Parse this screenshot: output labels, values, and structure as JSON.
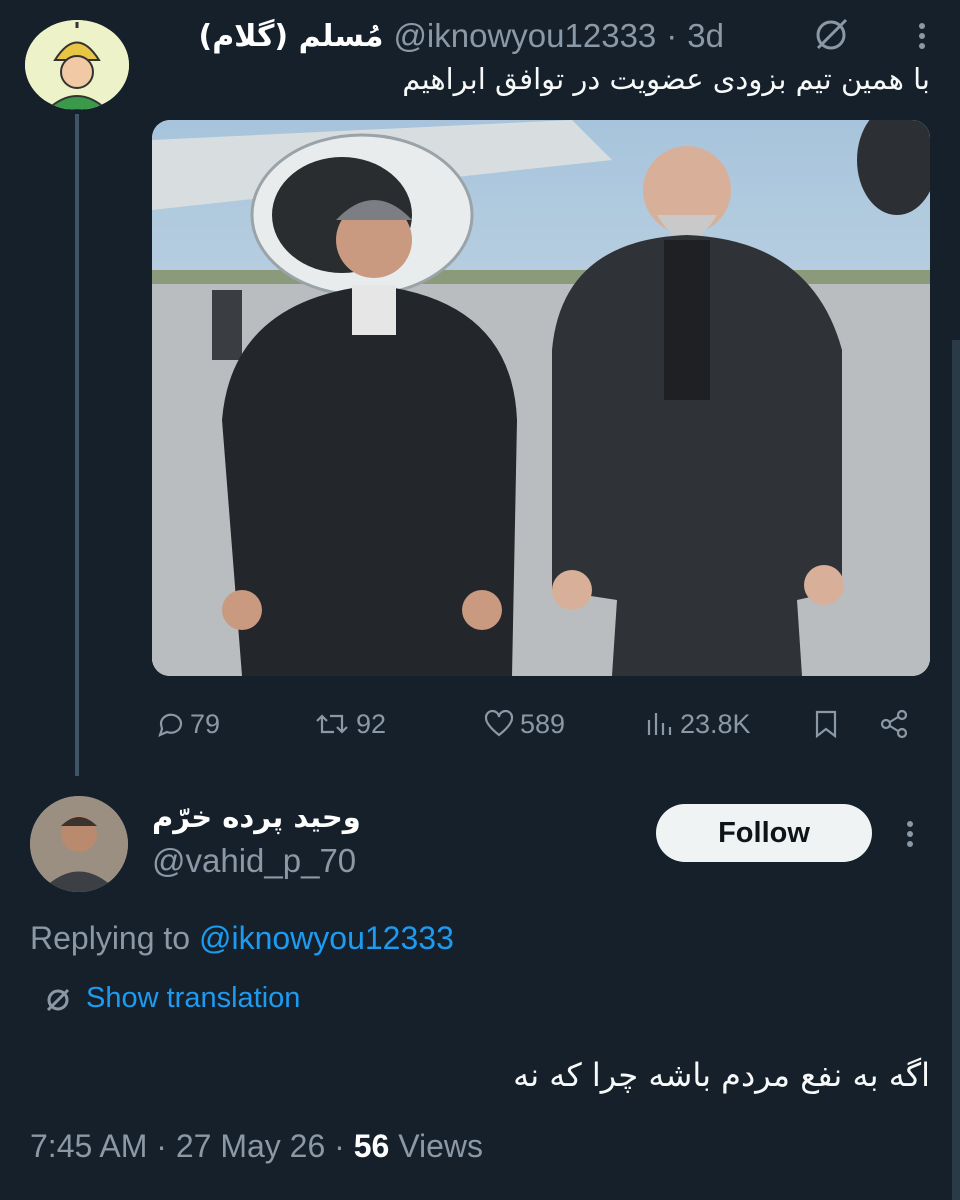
{
  "tweet": {
    "author_name": "مُسلم (گلام)",
    "author_handle": "@iknowyou12333",
    "separator": "·",
    "time": "3d",
    "text": "با همین تیم بزودی عضویت در توافق ابراهیم",
    "stats": {
      "replies": "79",
      "retweets": "92",
      "likes": "589",
      "views": "23.8K"
    }
  },
  "reply": {
    "author_name": "وحید پرده خرّم",
    "author_handle": "@vahid_p_70",
    "follow_label": "Follow",
    "replying_prefix": "Replying to",
    "replying_mention": "@iknowyou12333",
    "translate_label": "Show translation",
    "text": "اگه به نفع مردم باشه چرا که نه",
    "meta_time": "7:45 AM",
    "meta_date": "27 May 26",
    "meta_views_count": "56",
    "meta_views_label": "Views"
  },
  "icons": {
    "grok": "grok-icon",
    "more": "more-vertical-icon",
    "reply": "reply-icon",
    "retweet": "retweet-icon",
    "like": "heart-icon",
    "views": "views-icon",
    "bookmark": "bookmark-icon",
    "share": "share-icon",
    "translate": "translate-icon"
  },
  "colors": {
    "background": "#15202b",
    "accent": "#1d9bf0",
    "muted": "#8b98a5"
  }
}
